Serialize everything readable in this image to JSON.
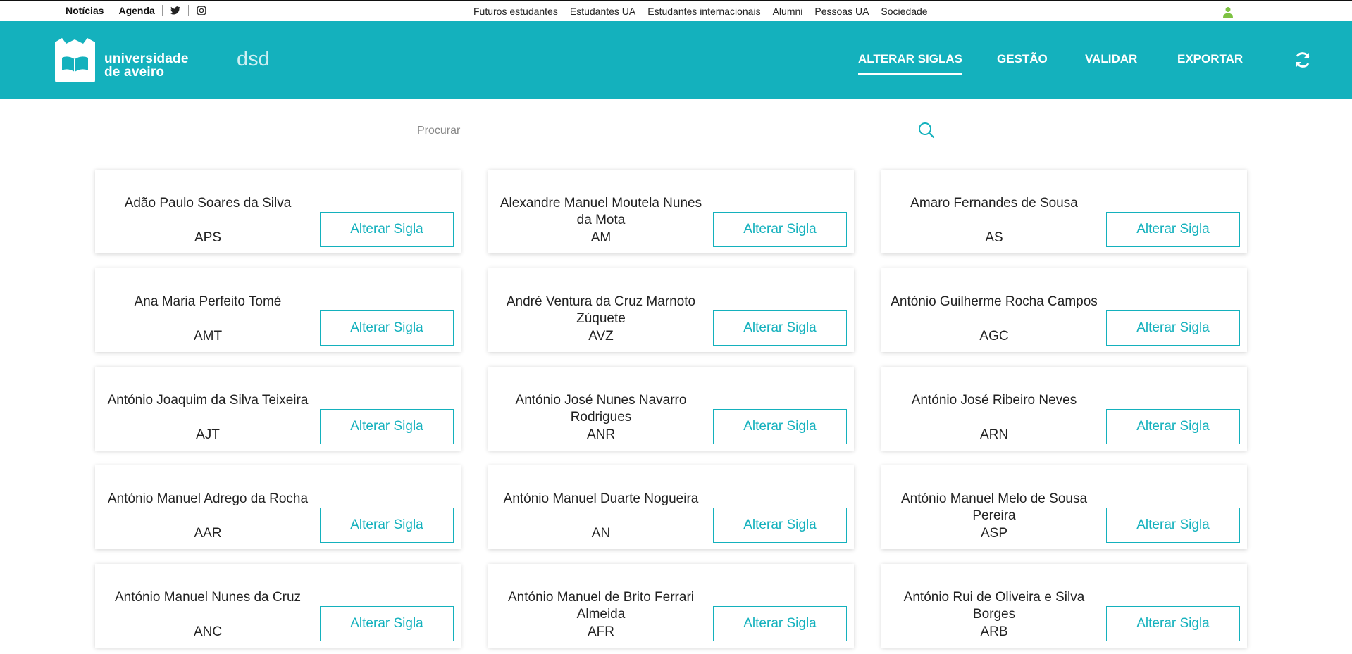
{
  "topbar": {
    "noticias": "Notícias",
    "agenda": "Agenda",
    "links": [
      "Futuros estudantes",
      "Estudantes UA",
      "Estudantes internacionais",
      "Alumni",
      "Pessoas UA",
      "Sociedade"
    ],
    "user_icon": "user-icon",
    "user_color": "#7dc242"
  },
  "header": {
    "bg_color": "#14b1bd",
    "brand_line1": "universidade",
    "brand_line2": "de aveiro",
    "app_name": "dsd",
    "nav": [
      "ALTERAR SIGLAS",
      "GESTÃO",
      "VALIDAR",
      "EXPORTAR"
    ],
    "active_nav": "ALTERAR SIGLAS"
  },
  "search": {
    "placeholder": "Procurar",
    "value": ""
  },
  "cards": [
    {
      "name": "Adão Paulo Soares da Silva",
      "sigla": "APS",
      "button": "Alterar Sigla"
    },
    {
      "name": "Alexandre Manuel Moutela Nunes da Mota",
      "sigla": "AM",
      "button": "Alterar Sigla"
    },
    {
      "name": "Amaro Fernandes de Sousa",
      "sigla": "AS",
      "button": "Alterar Sigla"
    },
    {
      "name": "Ana Maria Perfeito Tomé",
      "sigla": "AMT",
      "button": "Alterar Sigla"
    },
    {
      "name": "André Ventura da Cruz Marnoto Zúquete",
      "sigla": "AVZ",
      "button": "Alterar Sigla"
    },
    {
      "name": "António Guilherme Rocha Campos",
      "sigla": "AGC",
      "button": "Alterar Sigla"
    },
    {
      "name": "António Joaquim da Silva Teixeira",
      "sigla": "AJT",
      "button": "Alterar Sigla"
    },
    {
      "name": "António José Nunes Navarro Rodrigues",
      "sigla": "ANR",
      "button": "Alterar Sigla"
    },
    {
      "name": "António José Ribeiro Neves",
      "sigla": "ARN",
      "button": "Alterar Sigla"
    },
    {
      "name": "António Manuel Adrego da Rocha",
      "sigla": "AAR",
      "button": "Alterar Sigla"
    },
    {
      "name": "António Manuel Duarte Nogueira",
      "sigla": "AN",
      "button": "Alterar Sigla"
    },
    {
      "name": "António Manuel Melo de Sousa Pereira",
      "sigla": "ASP",
      "button": "Alterar Sigla"
    },
    {
      "name": "António Manuel Nunes da Cruz",
      "sigla": "ANC",
      "button": "Alterar Sigla"
    },
    {
      "name": "António Manuel de Brito Ferrari Almeida",
      "sigla": "AFR",
      "button": "Alterar Sigla"
    },
    {
      "name": "António Rui de Oliveira e Silva Borges",
      "sigla": "ARB",
      "button": "Alterar Sigla"
    }
  ]
}
